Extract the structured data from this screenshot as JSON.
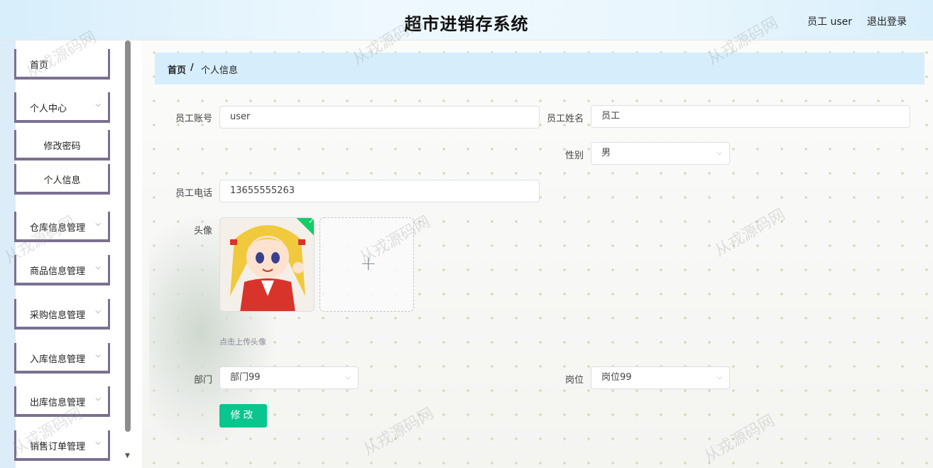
{
  "header": {
    "title": "超市进销存系统",
    "user": "员工 user",
    "logout": "退出登录"
  },
  "sidebar": {
    "items": [
      {
        "label": "首页"
      },
      {
        "label": "个人中心",
        "chevron": "⌵"
      },
      {
        "label": "修改密码"
      },
      {
        "label": "个人信息"
      },
      {
        "label": "仓库信息管理",
        "chevron": "⌵"
      },
      {
        "label": "商品信息管理",
        "chevron": "⌵"
      },
      {
        "label": "采购信息管理",
        "chevron": "⌵"
      },
      {
        "label": "入库信息管理",
        "chevron": "⌵"
      },
      {
        "label": "出库信息管理",
        "chevron": "⌵"
      },
      {
        "label": "销售订单管理",
        "chevron": "⌵"
      }
    ],
    "scroll_down_arrow": "▼"
  },
  "breadcrumb": {
    "home": "首页",
    "separator": "/",
    "current": "个人信息"
  },
  "form": {
    "account_label": "员工账号",
    "account_value": "user",
    "name_label": "员工姓名",
    "name_value": "员工",
    "gender_label": "性别",
    "gender_value": "男",
    "phone_label": "员工电话",
    "phone_value": "13655555263",
    "avatar_label": "头像",
    "upload_tip": "点击上传头像",
    "dept_label": "部门",
    "dept_value": "部门99",
    "position_label": "岗位",
    "position_value": "岗位99",
    "submit_label": "修改",
    "caret": "⌵",
    "plus": "+",
    "check": "✓"
  },
  "watermark": "从戎源码网",
  "colors": {
    "accent": "#09c58e",
    "breadcrumb_bg": "#d6eefc",
    "menu_border": "#7a7191"
  }
}
